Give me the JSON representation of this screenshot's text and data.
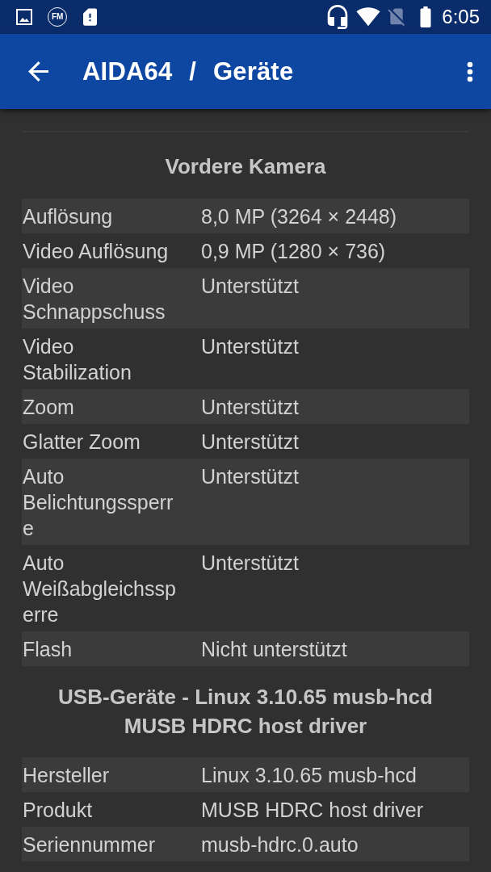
{
  "status_bar": {
    "fm_badge": "FM",
    "time": "6:05"
  },
  "app_bar": {
    "title": "AIDA64 / Geräte"
  },
  "sections": [
    {
      "title": "Vordere Kamera",
      "rows": [
        {
          "label": "Auflösung",
          "value": "8,0 MP (3264 × 2448)"
        },
        {
          "label": "Video Auflösung",
          "value": "0,9 MP (1280 × 736)"
        },
        {
          "label": "Video Schnappschuss",
          "value": "Unterstützt"
        },
        {
          "label": "Video Stabilization",
          "value": "Unterstützt"
        },
        {
          "label": "Zoom",
          "value": "Unterstützt"
        },
        {
          "label": "Glatter Zoom",
          "value": "Unterstützt"
        },
        {
          "label": "Auto Belichtungssperre",
          "value": "Unterstützt"
        },
        {
          "label": "Auto Weißabgleichssperre",
          "value": "Unterstützt"
        },
        {
          "label": "Flash",
          "value": "Nicht unterstützt"
        }
      ]
    },
    {
      "title": "USB-Geräte - Linux 3.10.65 musb-hcd MUSB HDRC host driver",
      "rows": [
        {
          "label": "Hersteller",
          "value": "Linux 3.10.65 musb-hcd"
        },
        {
          "label": "Produkt",
          "value": "MUSB HDRC host driver"
        },
        {
          "label": "Seriennummer",
          "value": "musb-hdrc.0.auto"
        }
      ]
    }
  ]
}
